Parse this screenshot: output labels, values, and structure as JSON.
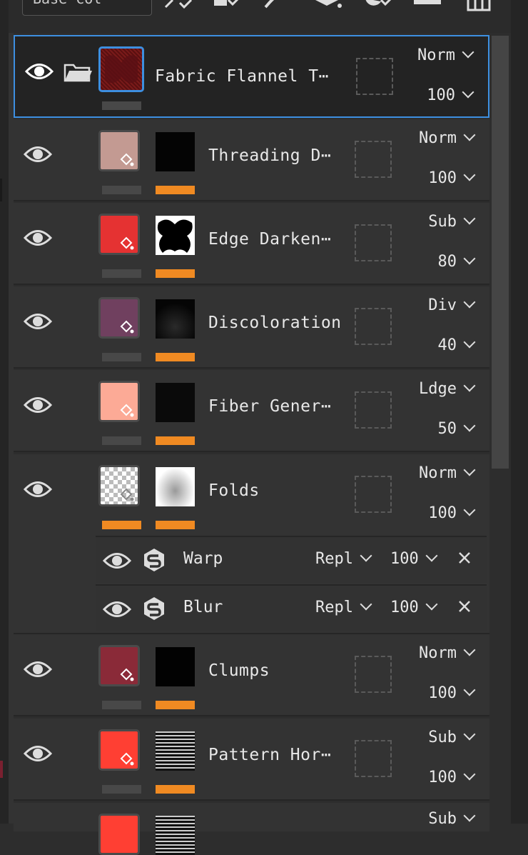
{
  "toolbar": {
    "preset_label": "Base col"
  },
  "layers": [
    {
      "name": "Fabric Flannel T⋯",
      "blend": "Norm",
      "opacity": "100",
      "color": "#7a1a1a"
    },
    {
      "name": "Threading D⋯",
      "blend": "Norm",
      "opacity": "100",
      "color": "#c39a92"
    },
    {
      "name": "Edge Darken⋯",
      "blend": "Sub",
      "opacity": "80",
      "color": "#e53232"
    },
    {
      "name": "Discoloration",
      "blend": "Div",
      "opacity": "40",
      "color": "#70405f"
    },
    {
      "name": "Fiber Gener⋯",
      "blend": "Ldge",
      "opacity": "50",
      "color": "#fcaa96"
    },
    {
      "name": "Folds",
      "blend": "Norm",
      "opacity": "100",
      "color": "checker"
    },
    {
      "name": "Clumps",
      "blend": "Norm",
      "opacity": "100",
      "color": "#8a2a38"
    },
    {
      "name": "Pattern Hor⋯",
      "blend": "Sub",
      "opacity": "100",
      "color": "#ff3f33"
    },
    {
      "name": "",
      "blend": "Sub",
      "opacity": "",
      "color": "#ff3f33"
    }
  ],
  "filters": [
    {
      "name": "Warp",
      "blend": "Repl",
      "opacity": "100"
    },
    {
      "name": "Blur",
      "blend": "Repl",
      "opacity": "100"
    }
  ]
}
